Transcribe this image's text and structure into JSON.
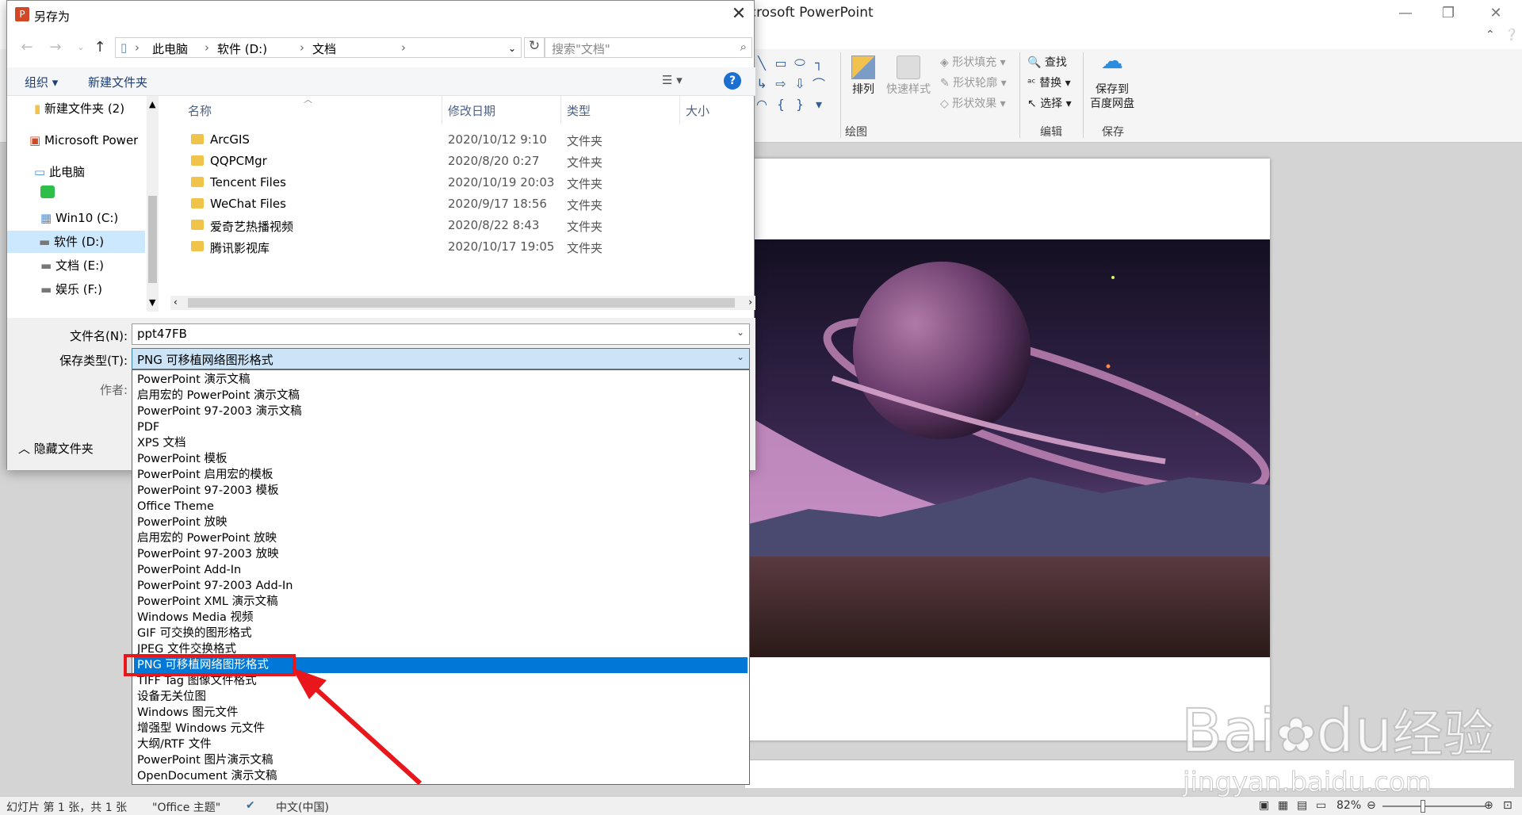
{
  "powerpoint": {
    "title": "Microsoft PowerPoint",
    "title_visible": "icrosoft PowerPoint",
    "ribbon": {
      "arrange": "排列",
      "quick_styles": "快速样式",
      "shape_fill": "形状填充",
      "shape_outline": "形状轮廓",
      "shape_effects": "形状效果",
      "find": "查找",
      "replace": "替换",
      "select": "选择",
      "save_to_baidu_1": "保存到",
      "save_to_baidu_2": "百度网盘",
      "group_drawing": "绘图",
      "group_editing": "编辑",
      "group_save": "保存"
    },
    "status": {
      "slide_info": "幻灯片 第 1 张，共 1 张",
      "theme": "\"Office 主题\"",
      "language": "中文(中国)",
      "zoom": "82%"
    }
  },
  "dialog": {
    "title": "另存为",
    "breadcrumb": [
      "此电脑",
      "软件 (D:)",
      "文档"
    ],
    "search_placeholder": "搜索\"文档\"",
    "organize": "组织 ▾",
    "new_folder": "新建文件夹",
    "tree": [
      {
        "label": "新建文件夹 (2)",
        "icon": "folder"
      },
      {
        "label": "Microsoft Power",
        "icon": "powerpoint"
      },
      {
        "label": "此电脑",
        "icon": "computer"
      },
      {
        "label": "",
        "icon": "app"
      },
      {
        "label": "Win10 (C:)",
        "icon": "drive"
      },
      {
        "label": "软件 (D:)",
        "icon": "drive"
      },
      {
        "label": "文档 (E:)",
        "icon": "drive"
      },
      {
        "label": "娱乐 (F:)",
        "icon": "drive"
      }
    ],
    "columns": {
      "name": "名称",
      "date": "修改日期",
      "type": "类型",
      "size": "大小"
    },
    "files": [
      {
        "name": "ArcGIS",
        "date": "2020/10/12 9:10",
        "type": "文件夹"
      },
      {
        "name": "QQPCMgr",
        "date": "2020/8/20 0:27",
        "type": "文件夹"
      },
      {
        "name": "Tencent Files",
        "date": "2020/10/19 20:03",
        "type": "文件夹"
      },
      {
        "name": "WeChat Files",
        "date": "2020/9/17 18:56",
        "type": "文件夹"
      },
      {
        "name": "爱奇艺热播视频",
        "date": "2020/8/22 8:43",
        "type": "文件夹"
      },
      {
        "name": "腾讯影视库",
        "date": "2020/10/17 19:05",
        "type": "文件夹"
      }
    ],
    "filename_label": "文件名(N):",
    "filename_value": "ppt47FB",
    "filetype_label": "保存类型(T):",
    "filetype_value": "PNG 可移植网络图形格式",
    "author_label": "作者:",
    "hide_folders": "隐藏文件夹",
    "type_options": [
      "PowerPoint 演示文稿",
      "启用宏的 PowerPoint 演示文稿",
      "PowerPoint 97-2003 演示文稿",
      "PDF",
      "XPS 文档",
      "PowerPoint 模板",
      "PowerPoint 启用宏的模板",
      "PowerPoint 97-2003 模板",
      "Office Theme",
      "PowerPoint 放映",
      "启用宏的 PowerPoint 放映",
      "PowerPoint 97-2003 放映",
      "PowerPoint Add-In",
      "PowerPoint 97-2003 Add-In",
      "PowerPoint XML 演示文稿",
      "Windows Media 视频",
      "GIF 可交换的图形格式",
      "JPEG 文件交换格式",
      "PNG 可移植网络图形格式",
      "TIFF Tag 图像文件格式",
      "设备无关位图",
      "Windows 图元文件",
      "增强型 Windows 元文件",
      "大纲/RTF 文件",
      "PowerPoint 图片演示文稿",
      "OpenDocument 演示文稿"
    ],
    "selected_option_index": 18
  },
  "watermark": {
    "brand": "Bai",
    "brand2": "du",
    "cn": "经验",
    "url": "jingyan.baidu.com"
  },
  "colors": {
    "accent": "#0078d7",
    "highlight": "#e8171b"
  }
}
